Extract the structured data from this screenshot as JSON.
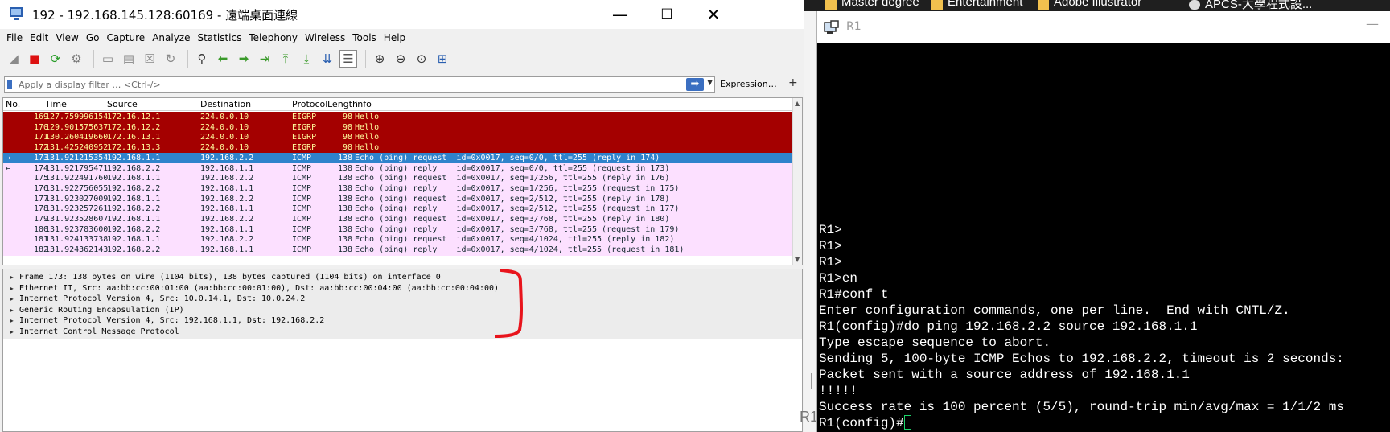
{
  "rdp_window": {
    "title": "192 - 192.168.145.128:60169 - 遠端桌面連線",
    "controls": {
      "minimize": "—",
      "maximize": "☐",
      "close": "✕"
    }
  },
  "menu": [
    "File",
    "Edit",
    "View",
    "Go",
    "Capture",
    "Analyze",
    "Statistics",
    "Telephony",
    "Wireless",
    "Tools",
    "Help"
  ],
  "toolbar_icons": [
    "shark-fin-start-icon",
    "stop-capture-icon",
    "restart-capture-icon",
    "capture-options-icon",
    "open-file-icon",
    "save-file-icon",
    "close-file-icon",
    "reload-file-icon",
    "find-packet-icon",
    "go-back-icon",
    "go-forward-icon",
    "go-to-packet-icon",
    "go-first-icon",
    "go-last-icon",
    "autoscroll-icon",
    "colorize-icon",
    "zoom-in-icon",
    "zoom-out-icon",
    "zoom-normal-icon",
    "resize-columns-icon"
  ],
  "filter": {
    "placeholder": "Apply a display filter … <Ctrl-/>",
    "expression_label": "Expression…",
    "plus": "+"
  },
  "packet_list": {
    "columns": [
      "No.",
      "Time",
      "Source",
      "Destination",
      "Protocol",
      "Length",
      "Info"
    ],
    "rows": [
      {
        "no": "169",
        "time": "127.759996154",
        "src": "172.16.12.1",
        "dst": "224.0.0.10",
        "proto": "EIGRP",
        "len": "98",
        "info": "Hello",
        "style": "eigrp",
        "marker": ""
      },
      {
        "no": "170",
        "time": "129.901575637",
        "src": "172.16.12.2",
        "dst": "224.0.0.10",
        "proto": "EIGRP",
        "len": "98",
        "info": "Hello",
        "style": "eigrp",
        "marker": ""
      },
      {
        "no": "171",
        "time": "130.260419660",
        "src": "172.16.13.1",
        "dst": "224.0.0.10",
        "proto": "EIGRP",
        "len": "98",
        "info": "Hello",
        "style": "eigrp",
        "marker": ""
      },
      {
        "no": "172",
        "time": "131.425240952",
        "src": "172.16.13.3",
        "dst": "224.0.0.10",
        "proto": "EIGRP",
        "len": "98",
        "info": "Hello",
        "style": "eigrp",
        "marker": ""
      },
      {
        "no": "173",
        "time": "131.921215354",
        "src": "192.168.1.1",
        "dst": "192.168.2.2",
        "proto": "ICMP",
        "len": "138",
        "info": "Echo (ping) request  id=0x0017, seq=0/0, ttl=255 (reply in 174)",
        "style": "selected",
        "marker": "→"
      },
      {
        "no": "174",
        "time": "131.921795471",
        "src": "192.168.2.2",
        "dst": "192.168.1.1",
        "proto": "ICMP",
        "len": "138",
        "info": "Echo (ping) reply    id=0x0017, seq=0/0, ttl=255 (request in 173)",
        "style": "icmp",
        "marker": "←"
      },
      {
        "no": "175",
        "time": "131.922491760",
        "src": "192.168.1.1",
        "dst": "192.168.2.2",
        "proto": "ICMP",
        "len": "138",
        "info": "Echo (ping) request  id=0x0017, seq=1/256, ttl=255 (reply in 176)",
        "style": "icmp",
        "marker": ""
      },
      {
        "no": "176",
        "time": "131.922756055",
        "src": "192.168.2.2",
        "dst": "192.168.1.1",
        "proto": "ICMP",
        "len": "138",
        "info": "Echo (ping) reply    id=0x0017, seq=1/256, ttl=255 (request in 175)",
        "style": "icmp",
        "marker": ""
      },
      {
        "no": "177",
        "time": "131.923027009",
        "src": "192.168.1.1",
        "dst": "192.168.2.2",
        "proto": "ICMP",
        "len": "138",
        "info": "Echo (ping) request  id=0x0017, seq=2/512, ttl=255 (reply in 178)",
        "style": "icmp",
        "marker": ""
      },
      {
        "no": "178",
        "time": "131.923257261",
        "src": "192.168.2.2",
        "dst": "192.168.1.1",
        "proto": "ICMP",
        "len": "138",
        "info": "Echo (ping) reply    id=0x0017, seq=2/512, ttl=255 (request in 177)",
        "style": "icmp",
        "marker": ""
      },
      {
        "no": "179",
        "time": "131.923528607",
        "src": "192.168.1.1",
        "dst": "192.168.2.2",
        "proto": "ICMP",
        "len": "138",
        "info": "Echo (ping) request  id=0x0017, seq=3/768, ttl=255 (reply in 180)",
        "style": "icmp",
        "marker": ""
      },
      {
        "no": "180",
        "time": "131.923783600",
        "src": "192.168.2.2",
        "dst": "192.168.1.1",
        "proto": "ICMP",
        "len": "138",
        "info": "Echo (ping) reply    id=0x0017, seq=3/768, ttl=255 (request in 179)",
        "style": "icmp",
        "marker": ""
      },
      {
        "no": "181",
        "time": "131.924133738",
        "src": "192.168.1.1",
        "dst": "192.168.2.2",
        "proto": "ICMP",
        "len": "138",
        "info": "Echo (ping) request  id=0x0017, seq=4/1024, ttl=255 (reply in 182)",
        "style": "icmp",
        "marker": ""
      },
      {
        "no": "182",
        "time": "131.924362143",
        "src": "192.168.2.2",
        "dst": "192.168.1.1",
        "proto": "ICMP",
        "len": "138",
        "info": "Echo (ping) reply    id=0x0017, seq=4/1024, ttl=255 (request in 181)",
        "style": "icmp",
        "marker": ""
      }
    ]
  },
  "details": [
    "Frame 173: 138 bytes on wire (1104 bits), 138 bytes captured (1104 bits) on interface 0",
    "Ethernet II, Src: aa:bb:cc:00:01:00 (aa:bb:cc:00:01:00), Dst: aa:bb:cc:00:04:00 (aa:bb:cc:00:04:00)",
    "Internet Protocol Version 4, Src: 10.0.14.1, Dst: 10.0.24.2",
    "Generic Routing Encapsulation (IP)",
    "Internet Protocol Version 4, Src: 192.168.1.1, Dst: 192.168.2.2",
    "Internet Control Message Protocol"
  ],
  "taskbar": [
    "Master degree",
    "Entertainment",
    "Adobe Illustrator",
    "APCS-大學程式設..."
  ],
  "left_fragment": "R1",
  "r1_window": {
    "title": "R1",
    "minimize": "—",
    "lines": [
      "R1>",
      "R1>",
      "R1>",
      "R1>en",
      "R1#conf t",
      "Enter configuration commands, one per line.  End with CNTL/Z.",
      "R1(config)#do ping 192.168.2.2 source 192.168.1.1",
      "Type escape sequence to abort.",
      "Sending 5, 100-byte ICMP Echos to 192.168.2.2, timeout is 2 seconds:",
      "Packet sent with a source address of 192.168.1.1",
      "!!!!!",
      "Success rate is 100 percent (5/5), round-trip min/avg/max = 1/1/2 ms"
    ],
    "prompt": "R1(config)#"
  },
  "colors": {
    "eigrp_bg": "#a40000",
    "eigrp_fg": "#fffc9c",
    "icmp_bg": "#fce0ff",
    "icmp_fg": "#12272e",
    "selected_bg": "#2f83cc",
    "selected_fg": "#ffffff",
    "annotation": "#e8141c"
  }
}
